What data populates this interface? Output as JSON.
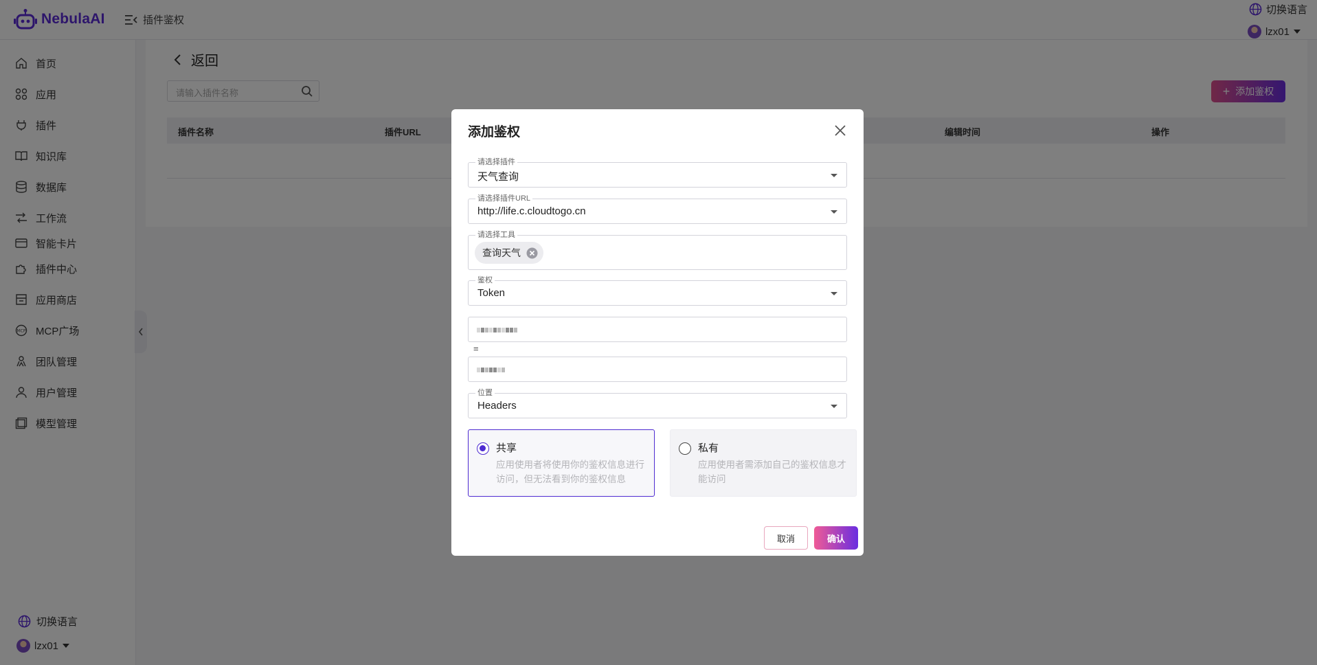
{
  "app": {
    "brand": "NebulaAI",
    "page_title": "插件鉴权"
  },
  "topbar": {
    "lang_label": "切换语言",
    "username": "lzx01"
  },
  "sidebar": {
    "items": [
      {
        "label": "首页",
        "icon": "home-icon"
      },
      {
        "label": "应用",
        "icon": "apps-icon"
      },
      {
        "label": "插件",
        "icon": "plug-icon"
      },
      {
        "label": "知识库",
        "icon": "book-icon"
      },
      {
        "label": "数据库",
        "icon": "database-icon"
      },
      {
        "label": "工作流",
        "icon": "workflow-icon"
      },
      {
        "label": "智能卡片",
        "icon": "card-icon"
      },
      {
        "label": "插件中心",
        "icon": "puzzle-icon"
      },
      {
        "label": "应用商店",
        "icon": "store-icon"
      },
      {
        "label": "MCP广场",
        "icon": "mcp-icon"
      },
      {
        "label": "团队管理",
        "icon": "team-icon"
      },
      {
        "label": "用户管理",
        "icon": "user-icon"
      },
      {
        "label": "模型管理",
        "icon": "model-icon"
      }
    ],
    "bottom_lang": "切换语言",
    "bottom_user": "lzx01"
  },
  "main": {
    "back_label": "返回",
    "search_placeholder": "请输入插件名称",
    "add_button": "添加鉴权",
    "columns": [
      "插件名称",
      "插件URL",
      "编辑时间",
      "操作"
    ]
  },
  "modal": {
    "title": "添加鉴权",
    "plugin": {
      "label": "请选择插件",
      "value": "天气查询"
    },
    "plugin_url": {
      "label": "请选择插件URL",
      "value": "http://life.c.cloudtogo.cn"
    },
    "tool": {
      "label": "请选择工具",
      "chip": "查询天气"
    },
    "auth": {
      "label": "鉴权",
      "value": "Token"
    },
    "equals": "=",
    "position": {
      "label": "位置",
      "value": "Headers"
    },
    "shared": {
      "title": "共享",
      "desc": "应用使用者将使用你的鉴权信息进行访问，但无法看到你的鉴权信息"
    },
    "private": {
      "title": "私有",
      "desc": "应用使用者需添加自己的鉴权信息才能访问"
    },
    "cancel": "取消",
    "confirm": "确认"
  },
  "colors": {
    "accent": "#4d2ad1",
    "brand": "#5b2bd6",
    "gradient_start": "#ef5b96",
    "gradient_end": "#6a2de0"
  }
}
